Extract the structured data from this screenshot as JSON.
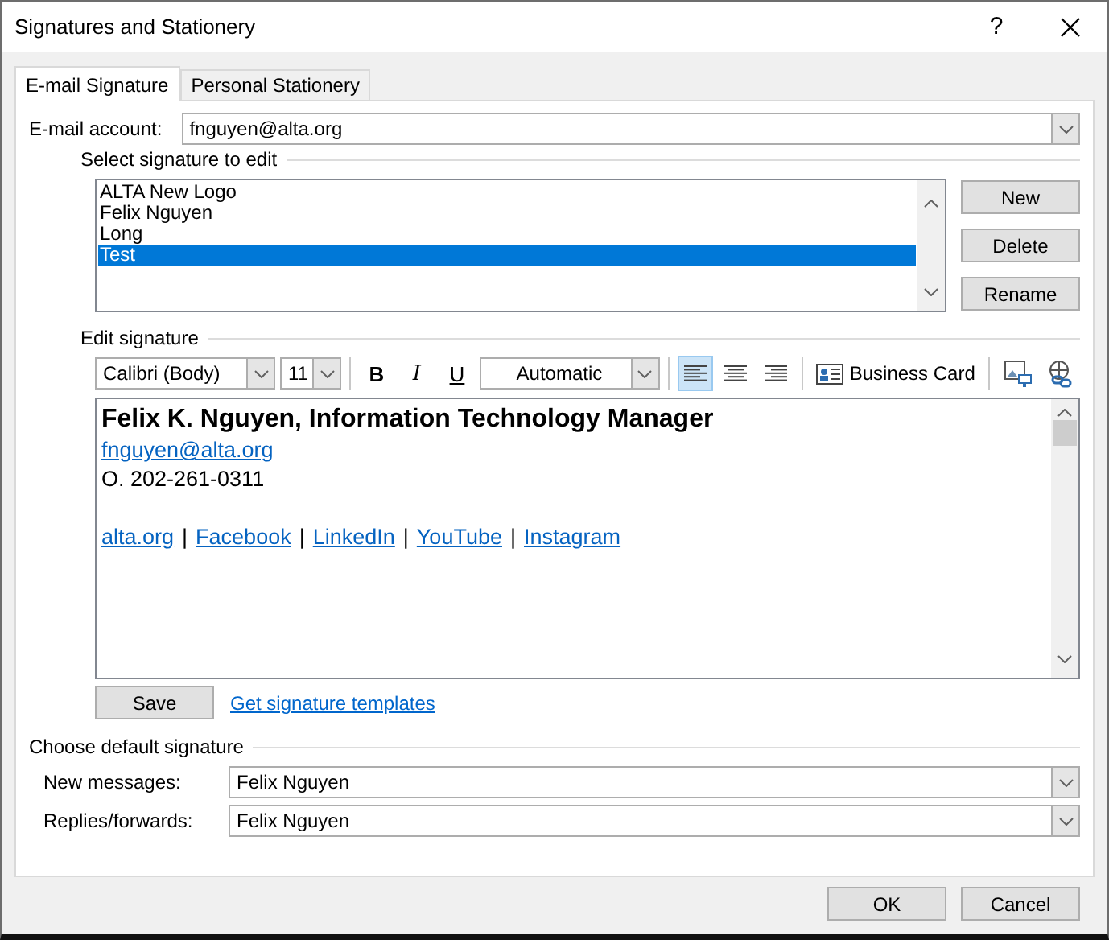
{
  "window": {
    "title": "Signatures and Stationery",
    "help": "?"
  },
  "tabs": [
    {
      "label": "E-mail Signature",
      "selected": true
    },
    {
      "label": "Personal Stationery",
      "selected": false
    }
  ],
  "account": {
    "label": "E-mail account:",
    "value": "fnguyen@alta.org"
  },
  "signatures": {
    "label": "Select signature to edit",
    "items": [
      {
        "label": "ALTA New Logo",
        "selected": false
      },
      {
        "label": "Felix Nguyen",
        "selected": false
      },
      {
        "label": "Long",
        "selected": false
      },
      {
        "label": "Test",
        "selected": true
      }
    ],
    "buttons": [
      {
        "label": "New"
      },
      {
        "label": "Delete"
      },
      {
        "label": "Rename"
      }
    ]
  },
  "editor": {
    "label": "Edit signature",
    "toolbar": {
      "font": "Calibri (Body)",
      "size": "11",
      "format_buttons": [
        {
          "kind": "bold",
          "label": "B"
        },
        {
          "kind": "italic",
          "label": "I"
        },
        {
          "kind": "underline",
          "label": "U"
        }
      ],
      "font_color_choice": "Automatic",
      "alignment": [
        {
          "kind": "left",
          "selected": true
        },
        {
          "kind": "center",
          "selected": false
        },
        {
          "kind": "right",
          "selected": false
        }
      ],
      "business_card": {
        "label": "Business Card"
      }
    },
    "content": [
      {
        "kind": "heading",
        "text": "Felix K. Nguyen, Information Technology Manager"
      },
      {
        "kind": "link",
        "text": "fnguyen@alta.org"
      },
      {
        "kind": "plain",
        "text": "O. 202-261-0311"
      },
      {
        "kind": "blank"
      },
      {
        "kind": "links",
        "items": [
          "alta.org",
          "Facebook",
          "LinkedIn",
          "YouTube",
          "Instagram"
        ],
        "separator": "|"
      }
    ],
    "save": {
      "label": "Save"
    },
    "templates_link": "Get signature templates"
  },
  "defaults": {
    "label": "Choose default signature",
    "fields": [
      {
        "label": "New messages:",
        "value": "Felix Nguyen"
      },
      {
        "label": "Replies/forwards:",
        "value": "Felix Nguyen"
      }
    ]
  },
  "buttons": [
    {
      "label": "OK"
    },
    {
      "label": "Cancel"
    }
  ]
}
